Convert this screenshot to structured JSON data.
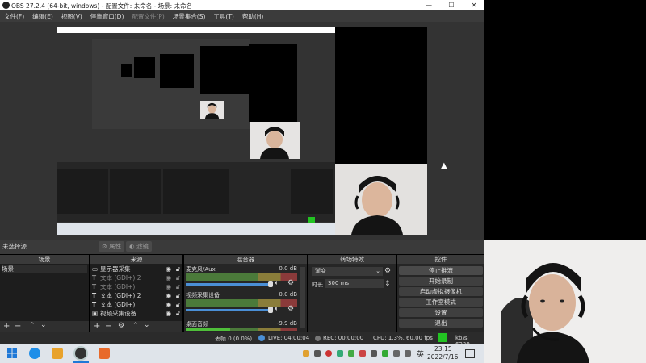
{
  "window": {
    "title": "OBS 27.2.4 (64-bit, windows) - 配置文件: 未命名 - 场景: 未命名",
    "minimize": "—",
    "maximize": "☐",
    "close": "✕"
  },
  "menu": [
    "文件(F)",
    "编辑(E)",
    "视图(V)",
    "停靠窗口(D)",
    "配置文件(P)",
    "场景集合(S)",
    "工具(T)",
    "帮助(H)"
  ],
  "toolbar": {
    "no_source": "未选择源",
    "properties": "属性",
    "filters": "滤镜"
  },
  "scenes": {
    "header": "场景",
    "items": [
      "场景"
    ]
  },
  "sources": {
    "header": "来源",
    "items": [
      {
        "icon": "monitor-icon",
        "label": "显示器采集"
      },
      {
        "icon": "text-icon",
        "label": "文本 (GDI+) 2"
      },
      {
        "icon": "text-icon",
        "label": "文本 (GDI+)"
      },
      {
        "icon": "text-icon",
        "label": "文本 (GDI+) 2"
      },
      {
        "icon": "text-icon",
        "label": "文本 (GDI+)"
      },
      {
        "icon": "camera-icon",
        "label": "视频采集设备"
      }
    ]
  },
  "mixer": {
    "header": "混音器",
    "channels": [
      {
        "name": "麦克风/Aux",
        "db": "0.0 dB",
        "level": 0.72
      },
      {
        "name": "视频采集设备",
        "db": "0.0 dB",
        "level": 0.72
      },
      {
        "name": "桌面音频",
        "db": "-9.9 dB",
        "level": 0.6
      }
    ]
  },
  "transitions": {
    "header": "转场特效",
    "type": "渐变",
    "duration_label": "时长",
    "duration": "300 ms"
  },
  "controls": {
    "header": "控件",
    "buttons": [
      "停止推流",
      "开始录制",
      "启动虚拟摄像机",
      "工作室模式",
      "设置",
      "退出"
    ]
  },
  "status": {
    "dropped": "丢帧 0 (0.0%)",
    "live": "LIVE: 04:00:04",
    "rec": "REC: 00:00:00",
    "cpu": "CPU: 1.3%, 60.00 fps",
    "kbps": "kb/s: 6239"
  },
  "taskbar": {
    "ime": "英",
    "time": "23:15",
    "date": "2022/7/16"
  },
  "colors": {
    "live_green": "#22c322",
    "dark_panel": "#2a2a2a",
    "accent_blue": "#4a8fd6"
  }
}
